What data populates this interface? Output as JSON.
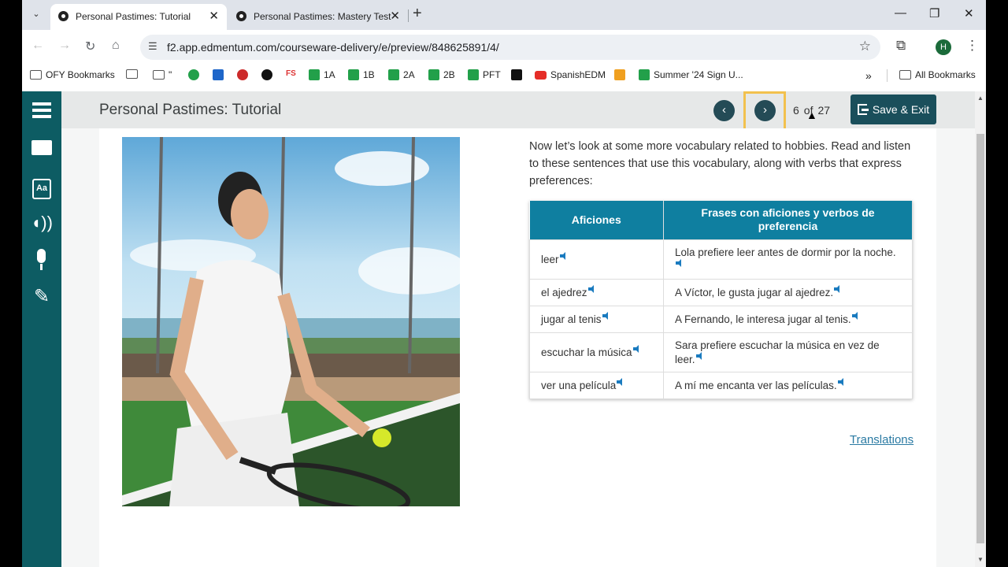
{
  "browser": {
    "tabs": [
      {
        "title": "Personal Pastimes: Tutorial",
        "active": true
      },
      {
        "title": "Personal Pastimes: Mastery Test",
        "active": false
      }
    ],
    "url": "f2.app.edmentum.com/courseware-delivery/e/preview/848625891/4/",
    "profile_initial": "H",
    "bookmarks": [
      {
        "label": "OFY Bookmarks",
        "icon": "folder-gear-icon"
      },
      {
        "label": "",
        "icon": "folder-icon"
      },
      {
        "label": "\"",
        "icon": "folder-icon"
      },
      {
        "label": "",
        "icon": "phone-icon"
      },
      {
        "label": "",
        "icon": "calendar-icon"
      },
      {
        "label": "",
        "icon": "apple-icon"
      },
      {
        "label": "",
        "icon": "edmentum-icon"
      },
      {
        "label": "FS",
        "icon": ""
      },
      {
        "label": "1A",
        "icon": "green-plus-icon"
      },
      {
        "label": "1B",
        "icon": "green-plus-icon"
      },
      {
        "label": "2A",
        "icon": "green-plus-icon"
      },
      {
        "label": "2B",
        "icon": "green-plus-icon"
      },
      {
        "label": "PFT",
        "icon": "green-plus-icon"
      },
      {
        "label": "",
        "icon": "tv-icon"
      },
      {
        "label": "SpanishEDM",
        "icon": "youtube-icon"
      },
      {
        "label": "",
        "icon": "wr-icon"
      },
      {
        "label": "Summer '24 Sign U...",
        "icon": "green-plus-icon"
      }
    ],
    "more": "»",
    "all_bookmarks": "All Bookmarks"
  },
  "app": {
    "page_title": "Personal Pastimes: Tutorial",
    "page_current": "6",
    "page_of": "of",
    "page_total": "27",
    "save_exit_label": "Save & Exit",
    "intro": "Now let’s look at some more vocabulary related to hobbies. Read and listen to these sentences that use this vocabulary, along with verbs that express preferences:",
    "table": {
      "headers": [
        "Aficiones",
        "Frases con aficiones y verbos de preferencia"
      ],
      "rows": [
        [
          "leer",
          "Lola prefiere leer antes de dormir por la noche."
        ],
        [
          "el ajedrez",
          "A Víctor, le gusta jugar al ajedrez."
        ],
        [
          "jugar al tenis",
          "A Fernando, le interesa jugar al tenis."
        ],
        [
          "escuchar la música",
          "Sara prefiere escuchar la música en vez de leer."
        ],
        [
          "ver una película",
          "A mí me encanta ver las películas."
        ]
      ]
    },
    "translations_link": "Translations",
    "colors": {
      "nav": "#0d5c63",
      "table_header": "#0f7fa0",
      "save_button": "#1a4f5b",
      "focus": "#f2c14e"
    }
  }
}
